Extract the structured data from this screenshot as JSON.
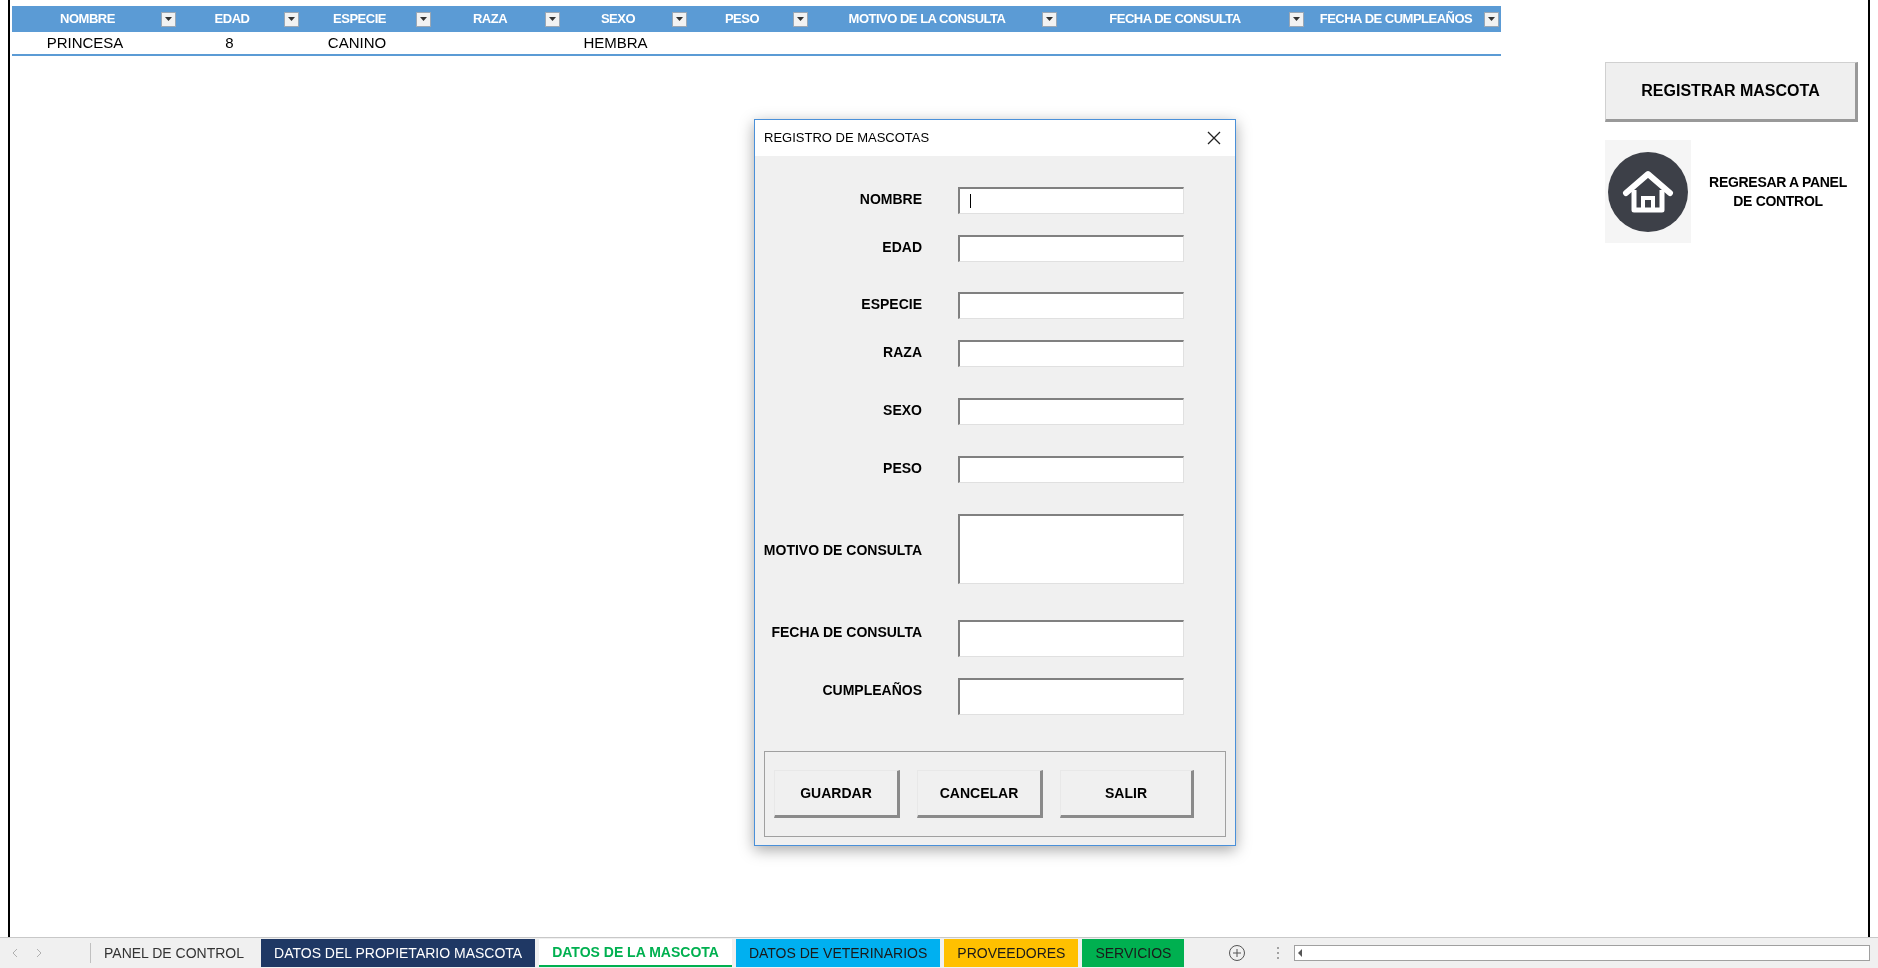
{
  "table": {
    "columns": [
      {
        "label": "NOMBRE",
        "filter": true
      },
      {
        "label": "EDAD",
        "filter": true
      },
      {
        "label": "ESPECIE",
        "filter": true
      },
      {
        "label": "RAZA",
        "filter": true
      },
      {
        "label": "SEXO",
        "filter": true
      },
      {
        "label": "PESO",
        "filter": true
      },
      {
        "label": "MOTIVO DE LA CONSULTA",
        "filter": true
      },
      {
        "label": "FECHA DE CONSULTA",
        "filter": true
      },
      {
        "label": "FECHA DE CUMPLEAÑOS",
        "filter": true
      }
    ],
    "rows": [
      [
        "PRINCESA",
        "8",
        "CANINO",
        "",
        "HEMBRA",
        "",
        "",
        "",
        ""
      ]
    ]
  },
  "actions": {
    "register_button": "REGISTRAR MASCOTA",
    "home_link": "REGRESAR A PANEL DE CONTROL"
  },
  "dialog": {
    "title": "REGISTRO DE MASCOTAS",
    "fields": [
      {
        "label": "NOMBRE",
        "kind": "text",
        "focused": true
      },
      {
        "label": "EDAD",
        "kind": "text",
        "focused": false
      },
      {
        "label": "ESPECIE",
        "kind": "text",
        "focused": false
      },
      {
        "label": "RAZA",
        "kind": "text",
        "focused": false
      },
      {
        "label": "SEXO",
        "kind": "text",
        "focused": false
      },
      {
        "label": "PESO",
        "kind": "text",
        "focused": false
      },
      {
        "label": "MOTIVO DE CONSULTA",
        "kind": "multiline",
        "focused": false
      },
      {
        "label": "FECHA DE CONSULTA",
        "kind": "text",
        "focused": false
      },
      {
        "label": "CUMPLEAÑOS",
        "kind": "text",
        "focused": false
      }
    ],
    "buttons": [
      "GUARDAR",
      "CANCELAR",
      "SALIR"
    ]
  },
  "sheet_tabs": [
    {
      "label": "PANEL DE CONTROL",
      "selected": false
    },
    {
      "label": "DATOS DEL PROPIETARIO MASCOTA",
      "selected": false,
      "color": "#1f3864"
    },
    {
      "label": "DATOS DE LA MASCOTA",
      "selected": true,
      "color": "#00b050"
    },
    {
      "label": "DATOS DE VETERINARIOS",
      "selected": false,
      "color": "#00b0f0"
    },
    {
      "label": "PROVEEDORES",
      "selected": false,
      "color": "#ffc000"
    },
    {
      "label": "SERVICIOS",
      "selected": false,
      "color": "#00b050"
    }
  ]
}
